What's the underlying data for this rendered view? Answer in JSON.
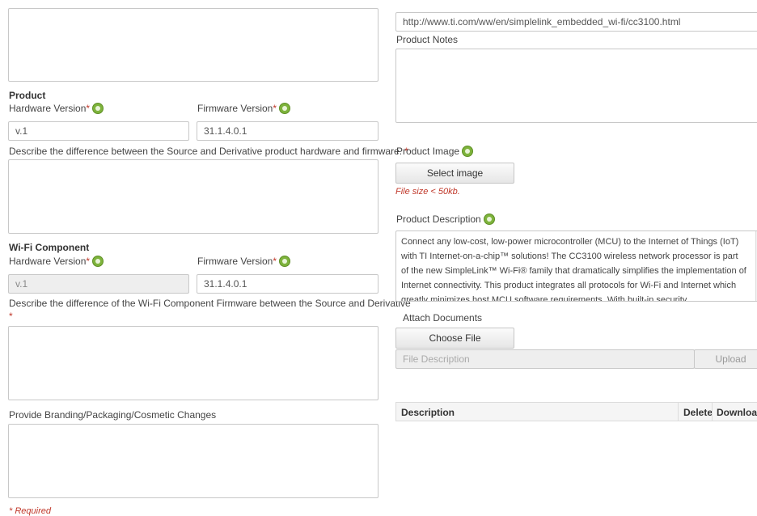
{
  "left": {
    "product": {
      "heading": "Product",
      "hardware_label": "Hardware Version",
      "firmware_label": "Firmware Version",
      "required_mark": "*",
      "hardware_value": "v.1",
      "firmware_value": "31.1.4.0.1",
      "describe_label": "Describe the difference between the Source and Derivative product hardware and firmware.",
      "describe_value": ""
    },
    "wifi": {
      "heading": "Wi-Fi Component",
      "hardware_label": "Hardware Version",
      "firmware_label": "Firmware Version",
      "hardware_value": "v.1",
      "firmware_value": "31.1.4.0.1",
      "describe_label": "Describe the difference of the Wi-Fi Component Firmware between the Source and Derivative",
      "describe_value": ""
    },
    "branding": {
      "label": "Provide Branding/Packaging/Cosmetic Changes",
      "value": ""
    },
    "required_note": "* Required"
  },
  "right": {
    "url_value": "http://www.ti.com/ww/en/simplelink_embedded_wi-fi/cc3100.html",
    "product_notes_label": "Product Notes",
    "product_image_label": "Product Image",
    "select_image_label": "Select image",
    "file_size_note": "File size < 50kb.",
    "product_description_label": "Product Description",
    "product_description_text": "Connect any low-cost, low-power microcontroller (MCU) to the Internet of Things (IoT) with TI Internet-on-a-chip™ solutions! The CC3100 wireless network processor is part of the new SimpleLink™ Wi-Fi® family that dramatically simplifies the implementation of Internet connectivity. This product integrates all protocols for Wi-Fi and Internet which greatly minimizes host MCU software requirements. With built-in security",
    "attach_documents_label": "Attach Documents",
    "choose_file_label": "Choose File",
    "file_description_placeholder": "File Description",
    "upload_label": "Upload",
    "table": {
      "col_description": "Description",
      "col_delete": "Delete",
      "col_download": "Download"
    }
  },
  "colors": {
    "required": "#c0392b",
    "help_icon": "#7eb33c"
  }
}
